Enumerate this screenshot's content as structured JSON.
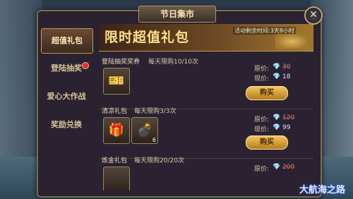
{
  "window": {
    "title": "节日集市",
    "close_glyph": "✕"
  },
  "sidebar": {
    "tabs": [
      {
        "label": "超值礼包",
        "active": true,
        "badge": false
      },
      {
        "label": "登陆抽奖",
        "active": false,
        "badge": true
      },
      {
        "label": "爱心大作战",
        "active": false,
        "badge": false
      },
      {
        "label": "奖励兑换",
        "active": false,
        "badge": false
      }
    ]
  },
  "banner": {
    "title": "限时超值礼包",
    "countdown": "活动剩余时间:3天8小时"
  },
  "labels": {
    "original": "原价:",
    "current": "现价:",
    "buy": "购买"
  },
  "items": [
    {
      "name": "登陆抽奖奖券",
      "limit": "每天限购10/10次",
      "original_price": "30",
      "current_price": "18",
      "slots": [
        {
          "icon": "ticket-icon",
          "glyph": "🎫",
          "count": ""
        }
      ]
    },
    {
      "name": "清凉礼包",
      "limit": "每天限购3/3次",
      "original_price": "120",
      "current_price": "99",
      "slots": [
        {
          "icon": "gift-box-icon",
          "glyph": "🎁",
          "count": ""
        },
        {
          "icon": "cannon-icon",
          "glyph": "💣",
          "count": "6"
        }
      ]
    },
    {
      "name": "炼金礼包",
      "limit": "每天限购20/20次",
      "original_price": "200",
      "current_price": "",
      "slots": []
    }
  ],
  "logo": "大航海之路",
  "colors": {
    "accent": "#f4c55c",
    "gem": "#7fc8ff",
    "badge": "#e33030"
  }
}
